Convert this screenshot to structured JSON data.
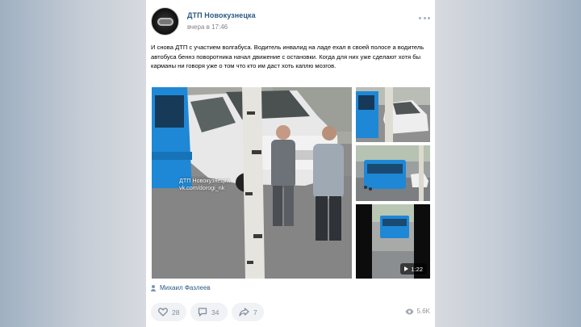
{
  "post": {
    "group_name": "ДТП Новокузнецка",
    "time": "вчера в 17:46",
    "text": "И снова ДТП с участием волгабуса. Водитель инвалид на ладе ехал в своей полосе а водитель автобуса беннз поворотника начал движение с остановки. Когда для них уже сделают хотя бы карманы ни говоря уже о том что кто им даст хоть каплю мозгов."
  },
  "media": {
    "watermark_name": "ДТП Новокузнецка",
    "watermark_url": "vk.com/dorogi_nk",
    "video_duration": "1:22"
  },
  "author": {
    "name": "Михаил Фазлеев"
  },
  "actions": {
    "likes": "28",
    "comments": "34",
    "shares": "7",
    "views": "5.6K"
  },
  "colors": {
    "link": "#2a5885",
    "bus_blue": "#1e88d6",
    "button_bg": "#f0f2f5"
  },
  "icons": [
    "more-icon",
    "heart-icon",
    "comment-icon",
    "share-icon",
    "eye-icon",
    "play-icon",
    "person-icon"
  ]
}
